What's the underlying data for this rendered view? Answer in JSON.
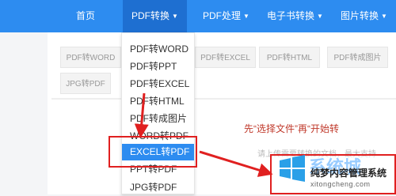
{
  "nav": {
    "items": [
      {
        "label": "首页"
      },
      {
        "label": "PDF转换",
        "caret": "▼"
      },
      {
        "label": "PDF处理",
        "caret": "▼"
      },
      {
        "label": "电子书转换",
        "caret": "▼"
      },
      {
        "label": "图片转换",
        "caret": "▼"
      }
    ]
  },
  "tags": [
    "PDF转WORD",
    "PDF转EXCEL",
    "PDF转HTML",
    "PDF转成图片",
    "JPG转PDF"
  ],
  "dropdown": {
    "items": [
      "PDF转WORD",
      "PDF转PPT",
      "PDF转EXCEL",
      "PDF转HTML",
      "PDF转成图片",
      "WORD转PDF",
      "EXCEL转PDF",
      "PPT转PDF",
      "JPG转PDF"
    ],
    "selected_index": 6
  },
  "main": {
    "instruction": "先“选择文件”再“开始转",
    "hint": "请上传需要转换的文档，最大支持"
  },
  "watermark": {
    "brand": "系统城",
    "text": "纯梦内容管理系统",
    "url": "xitongcheng.com"
  },
  "colors": {
    "nav_bg": "#2d8cf0",
    "nav_active": "#1e6fd1",
    "annotation_red": "#e02020",
    "instruction_red": "#c0392b"
  }
}
